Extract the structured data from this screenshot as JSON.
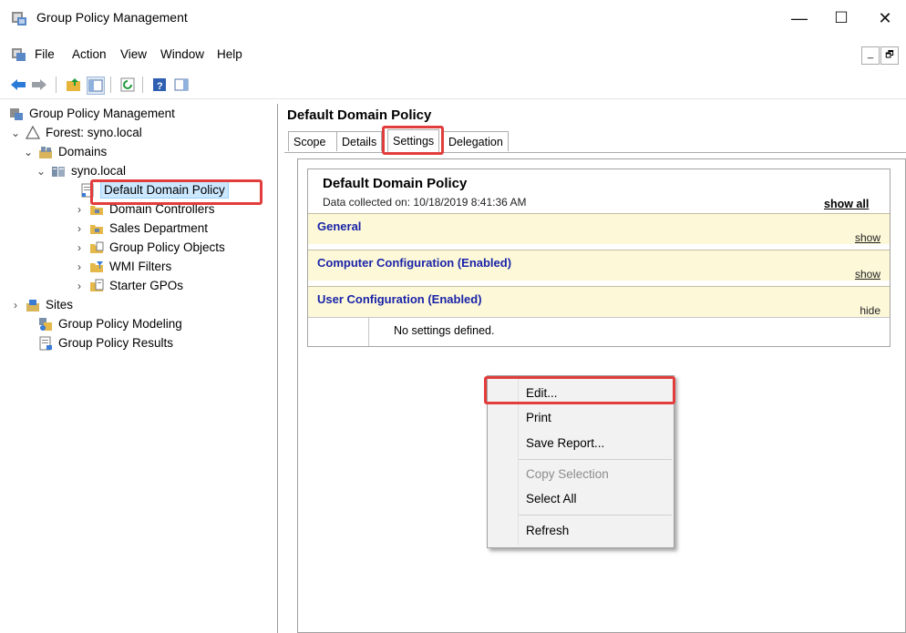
{
  "window": {
    "title": "Group Policy Management",
    "minimize": "—",
    "maximize": "☐",
    "close": "✕",
    "inner_min": "_",
    "inner_restore": "🗗"
  },
  "menu": [
    "File",
    "Action",
    "View",
    "Window",
    "Help"
  ],
  "tree": {
    "root": "Group Policy Management",
    "forest": "Forest: syno.local",
    "domains": "Domains",
    "domain": "syno.local",
    "items": [
      "Default Domain Policy",
      "Domain Controllers",
      "Sales Department",
      "Group Policy Objects",
      "WMI Filters",
      "Starter GPOs"
    ],
    "sites": "Sites",
    "modeling": "Group Policy Modeling",
    "results": "Group Policy Results"
  },
  "right": {
    "header": "Default Domain Policy",
    "tabs": [
      "Scope",
      "Details",
      "Settings",
      "Delegation"
    ],
    "active_tab": "Settings",
    "report": {
      "title": "Default Domain Policy",
      "collected": "Data collected on: 10/18/2019 8:41:36 AM",
      "show_all": "show all",
      "sections": [
        {
          "label": "General",
          "action": "show"
        },
        {
          "label": "Computer Configuration (Enabled)",
          "action": "show"
        },
        {
          "label": "User Configuration (Enabled)",
          "action": "hide"
        }
      ],
      "no_settings": "No settings defined."
    }
  },
  "context_menu": {
    "items": [
      "Edit...",
      "Print",
      "Save Report...",
      "Copy Selection",
      "Select All",
      "Refresh"
    ],
    "disabled": [
      "Copy Selection"
    ]
  },
  "colors": {
    "highlight": "#e23d3d",
    "section_bg": "#fdf8d8",
    "section_text": "#1a24a8",
    "selection": "#cce8ff"
  }
}
